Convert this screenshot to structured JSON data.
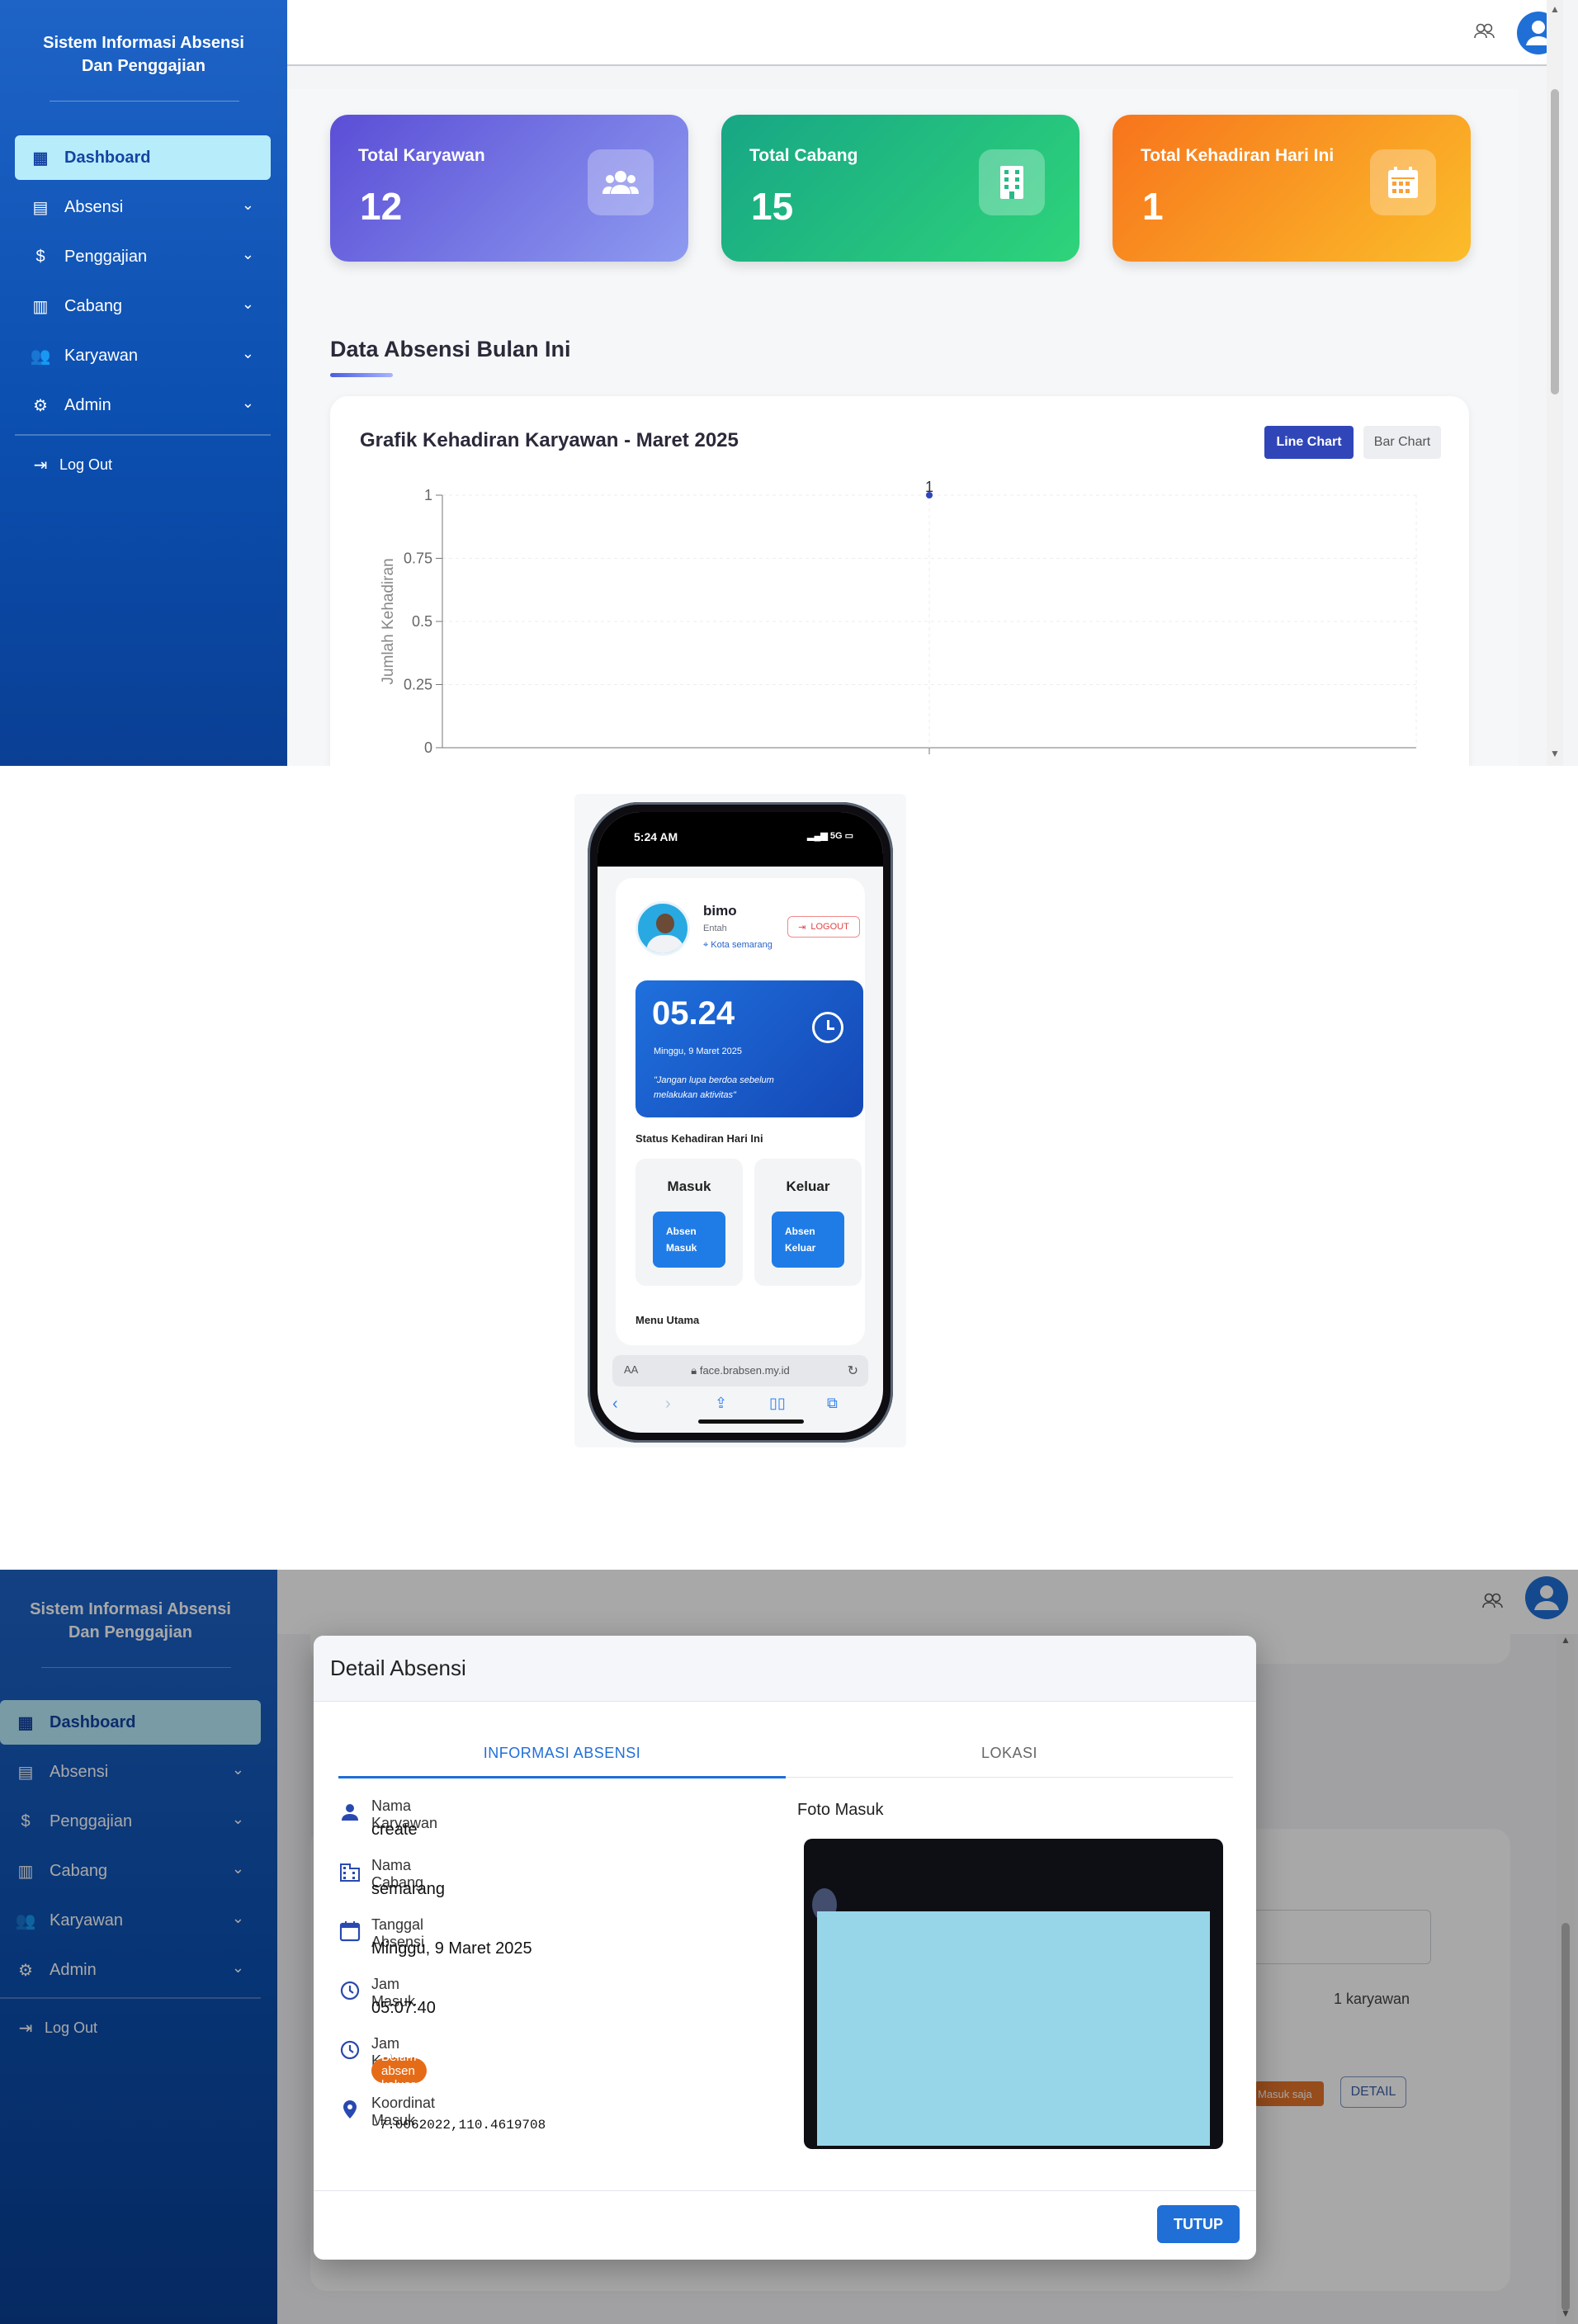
{
  "dashboard": {
    "sidebar": {
      "title_line1": "Sistem Informasi Absensi",
      "title_line2": "Dan Penggajian",
      "items": [
        {
          "label": "Dashboard",
          "icon": "dashboard-icon",
          "active": true
        },
        {
          "label": "Absensi",
          "icon": "calendar-icon"
        },
        {
          "label": "Penggajian",
          "icon": "dollar-icon"
        },
        {
          "label": "Cabang",
          "icon": "building-icon"
        },
        {
          "label": "Karyawan",
          "icon": "people-icon"
        },
        {
          "label": "Admin",
          "icon": "admin-icon"
        }
      ],
      "logout_label": "Log Out"
    },
    "stats": [
      {
        "label": "Total Karyawan",
        "value": "12",
        "icon": "users-icon",
        "color": "#5c5fe0"
      },
      {
        "label": "Total Cabang",
        "value": "15",
        "icon": "building-icon",
        "color": "#18b07c"
      },
      {
        "label": "Total Kehadiran Hari Ini",
        "value": "1",
        "icon": "calendar-icon",
        "color": "#f7881c"
      }
    ],
    "section_title": "Data Absensi Bulan Ini",
    "chart_title": "Grafik Kehadiran Karyawan - Maret 2025",
    "line_chart_button": "Line Chart",
    "bar_chart_button": "Bar Chart"
  },
  "chart_data": {
    "type": "line",
    "title": "Grafik Kehadiran Karyawan - Maret 2025",
    "xlabel": "",
    "ylabel": "Jumlah Kehadiran",
    "ylim": [
      0,
      1
    ],
    "yticks": [
      "1",
      "0.75",
      "0.5",
      "0.25",
      "0"
    ],
    "series": [
      {
        "values": [
          1
        ],
        "point_labels": [
          "1"
        ]
      }
    ],
    "grid": true,
    "accent": "#3046b8"
  },
  "mobile": {
    "status_time": "5:24 AM",
    "status_signal": "5G",
    "user_name": "bimo",
    "user_role": "Entah",
    "user_location": "Kota semarang",
    "logout_label": "LOGOUT",
    "clock_time": "05.24",
    "clock_date": "Minggu, 9 Maret 2025",
    "quote": "\"Jangan lupa berdoa sebelum melakukan aktivitas\"",
    "status_title": "Status Kehadiran Hari Ini",
    "masuk_label": "Masuk",
    "masuk_button_line1": "Absen",
    "masuk_button_line2": "Masuk",
    "keluar_label": "Keluar",
    "keluar_button_line1": "Absen",
    "keluar_button_line2": "Keluar",
    "menu_title": "Menu Utama",
    "url_aa": "AA",
    "url": "face.brabsen.my.id"
  },
  "detail": {
    "title": "Detail Absensi",
    "tab_info": "INFORMASI ABSENSI",
    "tab_lokasi": "LOKASI",
    "rows": [
      {
        "label": "Nama Karyawan",
        "value": "create",
        "icon": "person-icon"
      },
      {
        "label": "Nama Cabang",
        "value": "semarang",
        "icon": "building-icon"
      },
      {
        "label": "Tanggal Absensi",
        "value": "Minggu, 9 Maret 2025",
        "icon": "calendar-icon"
      },
      {
        "label": "Jam Masuk",
        "value": "05:07:40",
        "icon": "clock-icon"
      },
      {
        "label": "Jam Keluar",
        "value": "Belum absen keluar",
        "icon": "clock-icon"
      },
      {
        "label": "Koordinat Masuk",
        "value": "-7.0062022,110.4619708",
        "icon": "location-pin-icon"
      }
    ],
    "foto_label": "Foto Masuk",
    "close_button": "TUTUP",
    "background_count": "1 karyawan",
    "background_badge": "Masuk saja",
    "background_detail_button": "DETAIL"
  }
}
